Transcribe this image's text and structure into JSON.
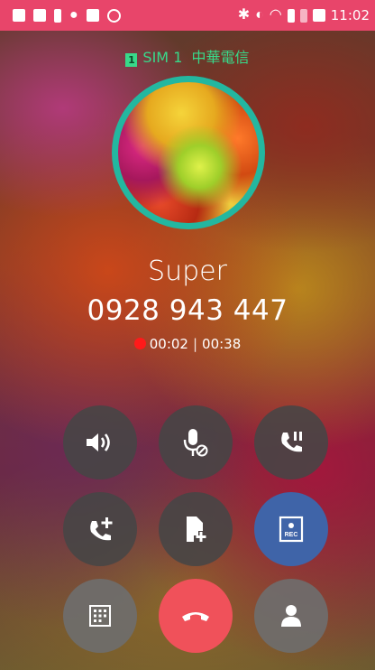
{
  "status_bar": {
    "time": "11:02",
    "icons": [
      "message-icon",
      "outlook-icon",
      "alert-icon",
      "mic-icon",
      "image-icon",
      "vpn-icon",
      "bluetooth-icon",
      "do-not-disturb-icon",
      "wifi-icon",
      "signal-sim1-icon",
      "signal-sim2-icon",
      "battery-charging-icon"
    ]
  },
  "sim": {
    "badge": "1",
    "label": "SIM 1",
    "carrier": "中華電信",
    "color": "#38d98a"
  },
  "contact": {
    "name": "Super",
    "number": "0928 943 447"
  },
  "call": {
    "recording_time": "00:02",
    "separator": "|",
    "duration": "00:38",
    "recording_color": "#ff1a1a"
  },
  "controls": [
    {
      "id": "speaker",
      "icon": "speaker-icon"
    },
    {
      "id": "mute",
      "icon": "mic-mute-icon"
    },
    {
      "id": "hold",
      "icon": "call-hold-icon"
    },
    {
      "id": "add-call",
      "icon": "add-call-icon"
    },
    {
      "id": "add-note",
      "icon": "add-note-icon"
    },
    {
      "id": "record",
      "icon": "rec-icon",
      "label": "REC"
    },
    {
      "id": "keypad",
      "icon": "dialpad-icon"
    },
    {
      "id": "end-call",
      "icon": "end-call-icon"
    },
    {
      "id": "contact",
      "icon": "contact-icon"
    }
  ],
  "colors": {
    "status_bar": "#e8456a",
    "avatar_ring": "#23b7a0",
    "end_call": "#f0515a",
    "record_button": "#3f64a8"
  }
}
